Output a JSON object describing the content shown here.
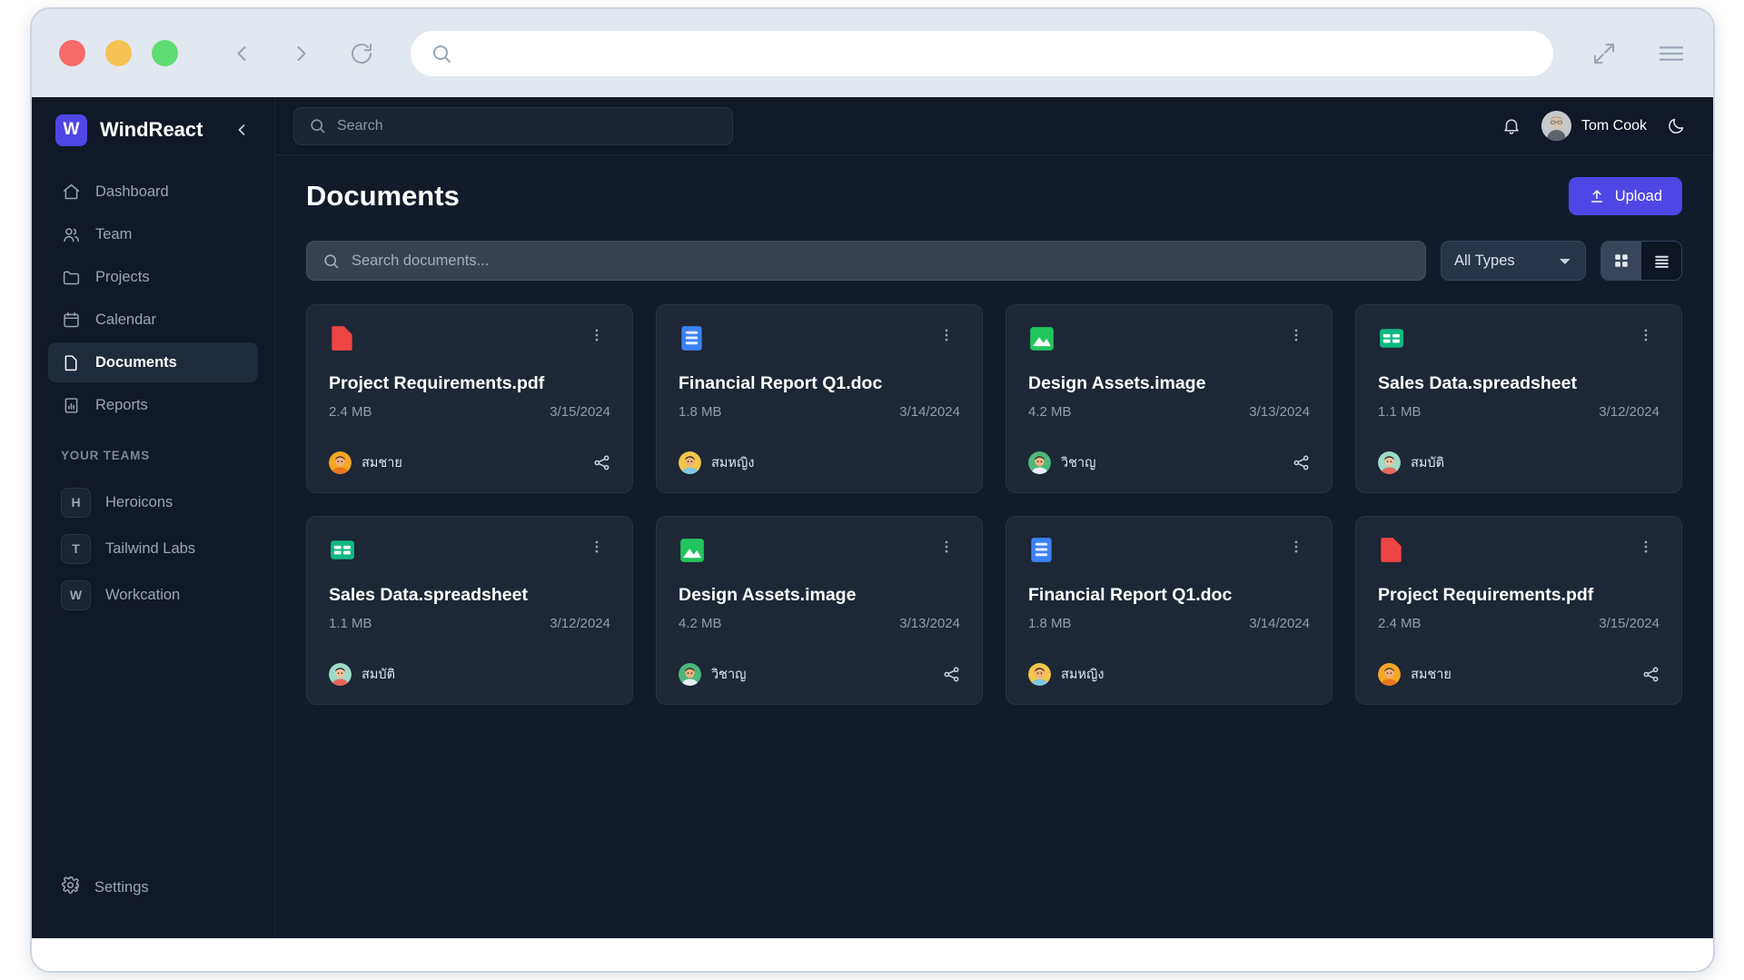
{
  "browser": {
    "url_value": "",
    "url_placeholder": "",
    "back_icon": "chevron-left-icon",
    "forward_icon": "chevron-right-icon",
    "reload_icon": "reload-icon",
    "search_icon": "search-icon",
    "expand_icon": "expand-arrows-icon",
    "menu_icon": "hamburger-menu-icon"
  },
  "sidebar": {
    "brand_initial": "W",
    "brand_name": "WindReact",
    "collapse_icon": "chevron-left-icon",
    "items": [
      {
        "label": "Dashboard",
        "icon": "home-icon",
        "active": false
      },
      {
        "label": "Team",
        "icon": "users-icon",
        "active": false
      },
      {
        "label": "Projects",
        "icon": "folder-icon",
        "active": false
      },
      {
        "label": "Calendar",
        "icon": "calendar-icon",
        "active": false
      },
      {
        "label": "Documents",
        "icon": "document-icon",
        "active": true
      },
      {
        "label": "Reports",
        "icon": "chart-document-icon",
        "active": false
      }
    ],
    "teams_label": "YOUR TEAMS",
    "teams": [
      {
        "badge": "H",
        "label": "Heroicons"
      },
      {
        "badge": "T",
        "label": "Tailwind Labs"
      },
      {
        "badge": "W",
        "label": "Workcation"
      }
    ],
    "settings_label": "Settings",
    "settings_icon": "gear-icon"
  },
  "topbar": {
    "search_placeholder": "Search",
    "search_value": "",
    "search_icon": "search-icon",
    "bell_icon": "bell-icon",
    "user_name": "Tom Cook",
    "theme_icon": "moon-icon"
  },
  "page": {
    "title": "Documents",
    "upload_label": "Upload",
    "upload_icon": "upload-arrow-icon",
    "upload_color": "#4f46e5"
  },
  "filters": {
    "search_placeholder": "Search documents...",
    "search_value": "",
    "search_icon": "search-icon",
    "type_selected": "All Types",
    "type_options": [
      "All Types"
    ],
    "grid_view_icon": "grid-view-icon",
    "list_view_icon": "list-view-icon",
    "active_view": "list"
  },
  "documents": [
    {
      "name": "Project Requirements.pdf",
      "size": "2.4 MB",
      "date": "3/15/2024",
      "owner": "สมชาย",
      "type": "pdf",
      "icon": "pdf-file-icon",
      "color": "#ef4444",
      "avatar": "male-orange",
      "shareable": true
    },
    {
      "name": "Financial Report Q1.doc",
      "size": "1.8 MB",
      "date": "3/14/2024",
      "owner": "สมหญิง",
      "type": "doc",
      "icon": "doc-file-icon",
      "color": "#3b82f6",
      "avatar": "male-yellow",
      "shareable": false
    },
    {
      "name": "Design Assets.image",
      "size": "4.2 MB",
      "date": "3/13/2024",
      "owner": "วิชาญ",
      "type": "image",
      "icon": "image-file-icon",
      "color": "#22c55e",
      "avatar": "male-green",
      "shareable": true
    },
    {
      "name": "Sales Data.spreadsheet",
      "size": "1.1 MB",
      "date": "3/12/2024",
      "owner": "สมบัติ",
      "type": "spreadsheet",
      "icon": "spreadsheet-file-icon",
      "color": "#10b981",
      "avatar": "female-teal",
      "shareable": false
    },
    {
      "name": "Sales Data.spreadsheet",
      "size": "1.1 MB",
      "date": "3/12/2024",
      "owner": "สมบัติ",
      "type": "spreadsheet",
      "icon": "spreadsheet-file-icon",
      "color": "#10b981",
      "avatar": "female-teal",
      "shareable": false
    },
    {
      "name": "Design Assets.image",
      "size": "4.2 MB",
      "date": "3/13/2024",
      "owner": "วิชาญ",
      "type": "image",
      "icon": "image-file-icon",
      "color": "#22c55e",
      "avatar": "male-green",
      "shareable": true
    },
    {
      "name": "Financial Report Q1.doc",
      "size": "1.8 MB",
      "date": "3/14/2024",
      "owner": "สมหญิง",
      "type": "doc",
      "icon": "doc-file-icon",
      "color": "#3b82f6",
      "avatar": "male-yellow",
      "shareable": false
    },
    {
      "name": "Project Requirements.pdf",
      "size": "2.4 MB",
      "date": "3/15/2024",
      "owner": "สมชาย",
      "type": "pdf",
      "icon": "pdf-file-icon",
      "color": "#ef4444",
      "avatar": "male-orange",
      "shareable": true
    }
  ]
}
